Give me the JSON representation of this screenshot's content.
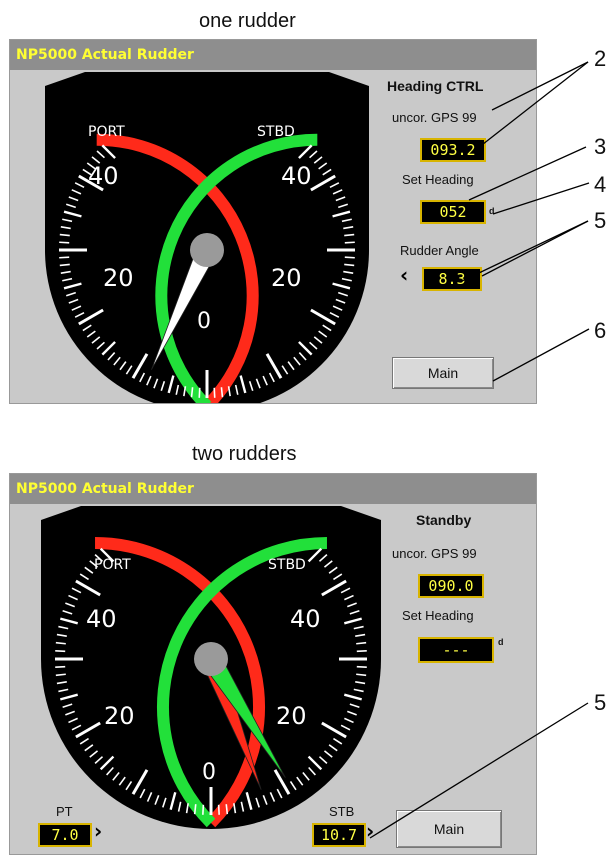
{
  "panel1": {
    "caption": "one rudder",
    "title": "NP5000 Actual Rudder",
    "gauge": {
      "port_label": "PORT",
      "stbd_label": "STBD",
      "scale_labels": [
        "40",
        "20",
        "0",
        "20",
        "40"
      ]
    },
    "rudder_angle_deg": 8.3,
    "mode": "Heading CTRL",
    "gps_label": "uncor. GPS 99",
    "gps_value": "093.2",
    "set_heading_label": "Set Heading",
    "set_heading_value": "052",
    "set_heading_unit": "d",
    "rudder_angle_label": "Rudder Angle",
    "rudder_angle_value": "8.3",
    "main_button": "Main"
  },
  "panel2": {
    "caption": "two rudders",
    "title": "NP5000 Actual Rudder",
    "gauge": {
      "port_label": "PORT",
      "stbd_label": "STBD",
      "scale_labels": [
        "40",
        "20",
        "0",
        "20",
        "40"
      ]
    },
    "port_rudder_deg": 7.0,
    "stbd_rudder_deg": 10.7,
    "mode": "Standby",
    "gps_label": "uncor. GPS 99",
    "gps_value": "090.0",
    "set_heading_label": "Set Heading",
    "set_heading_value": "---",
    "set_heading_unit": "d",
    "pt_label": "PT",
    "pt_value": "7.0",
    "stb_label": "STB",
    "stb_value": "10.7",
    "main_button": "Main"
  },
  "callouts": {
    "c2": "2",
    "c3": "3",
    "c4": "4",
    "c5a": "5",
    "c6": "6",
    "c5b": "5"
  },
  "colors": {
    "port": "#ff2a1a",
    "stbd": "#22e03a",
    "needle": "#ffffff",
    "hub": "#9a9a9a",
    "title_text": "#ffff33",
    "value_text": "#ffff44"
  }
}
